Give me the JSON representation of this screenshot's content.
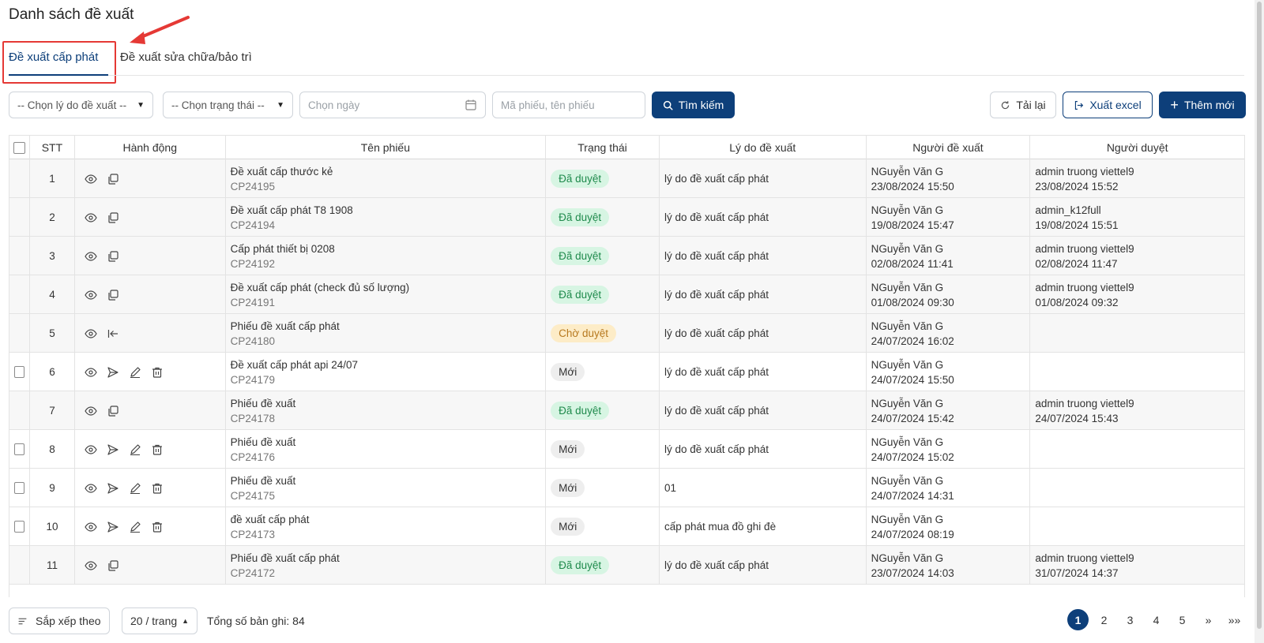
{
  "page": {
    "title": "Danh sách đề xuất"
  },
  "tabs": [
    {
      "label": "Đề xuất cấp phát",
      "active": true
    },
    {
      "label": "Đề xuất sửa chữa/bảo trì",
      "active": false
    }
  ],
  "filters": {
    "reason_select": "-- Chọn lý do đề xuất --",
    "status_select": "-- Chọn trạng thái --",
    "date_placeholder": "Chọn ngày",
    "search_placeholder": "Mã phiếu, tên phiếu",
    "search_button": "Tìm kiếm"
  },
  "toolbar": {
    "reload": "Tải lại",
    "export": "Xuất excel",
    "add_new": "Thêm mới"
  },
  "table": {
    "headers": [
      "STT",
      "Hành động",
      "Tên phiếu",
      "Trạng thái",
      "Lý do đề xuất",
      "Người đề xuất",
      "Người duyệt"
    ],
    "rows": [
      {
        "stt": "1",
        "name": "Đề xuất cấp thước kẻ",
        "code": "CP24195",
        "status": "Đã duyệt",
        "reason": "lý do đề xuất cấp phát",
        "proposer": "NGuyễn Văn G",
        "proposed_at": "23/08/2024 15:50",
        "approver": "admin truong viettel9",
        "approved_at": "23/08/2024 15:52"
      },
      {
        "stt": "2",
        "name": "Đề xuất cấp phát T8 1908",
        "code": "CP24194",
        "status": "Đã duyệt",
        "reason": "lý do đề xuất cấp phát",
        "proposer": "NGuyễn Văn G",
        "proposed_at": "19/08/2024 15:47",
        "approver": "admin_k12full",
        "approved_at": "19/08/2024 15:51"
      },
      {
        "stt": "3",
        "name": "Cấp phát thiết bị 0208",
        "code": "CP24192",
        "status": "Đã duyệt",
        "reason": "lý do đề xuất cấp phát",
        "proposer": "NGuyễn Văn G",
        "proposed_at": "02/08/2024 11:41",
        "approver": "admin truong viettel9",
        "approved_at": "02/08/2024 11:47"
      },
      {
        "stt": "4",
        "name": "Đề xuất cấp phát (check đủ số lượng)",
        "code": "CP24191",
        "status": "Đã duyệt",
        "reason": "lý do đề xuất cấp phát",
        "proposer": "NGuyễn Văn G",
        "proposed_at": "01/08/2024 09:30",
        "approver": "admin truong viettel9",
        "approved_at": "01/08/2024 09:32"
      },
      {
        "stt": "5",
        "name": "Phiếu đề xuất cấp phát",
        "code": "CP24180",
        "status": "Chờ duyệt",
        "reason": "lý do đề xuất cấp phát",
        "proposer": "NGuyễn Văn G",
        "proposed_at": "24/07/2024 16:02",
        "approver": "",
        "approved_at": ""
      },
      {
        "stt": "6",
        "name": "Đề xuất cấp phát api 24/07",
        "code": "CP24179",
        "status": "Mới",
        "reason": "lý do đề xuất cấp phát",
        "proposer": "NGuyễn Văn G",
        "proposed_at": "24/07/2024 15:50",
        "approver": "",
        "approved_at": ""
      },
      {
        "stt": "7",
        "name": "Phiếu đề xuất",
        "code": "CP24178",
        "status": "Đã duyệt",
        "reason": "lý do đề xuất cấp phát",
        "proposer": "NGuyễn Văn G",
        "proposed_at": "24/07/2024 15:42",
        "approver": "admin truong viettel9",
        "approved_at": "24/07/2024 15:43"
      },
      {
        "stt": "8",
        "name": "Phiếu đề xuất",
        "code": "CP24176",
        "status": "Mới",
        "reason": "lý do đề xuất cấp phát",
        "proposer": "NGuyễn Văn G",
        "proposed_at": "24/07/2024 15:02",
        "approver": "",
        "approved_at": ""
      },
      {
        "stt": "9",
        "name": "Phiếu đề xuất",
        "code": "CP24175",
        "status": "Mới",
        "reason": "01",
        "proposer": "NGuyễn Văn G",
        "proposed_at": "24/07/2024 14:31",
        "approver": "",
        "approved_at": ""
      },
      {
        "stt": "10",
        "name": "đề xuất cấp phát",
        "code": "CP24173",
        "status": "Mới",
        "reason": "cấp phát mua đồ ghi đè",
        "proposer": "NGuyễn Văn G",
        "proposed_at": "24/07/2024 08:19",
        "approver": "",
        "approved_at": ""
      },
      {
        "stt": "11",
        "name": "Phiếu đề xuất cấp phát",
        "code": "CP24172",
        "status": "Đã duyệt",
        "reason": "lý do đề xuất cấp phát",
        "proposer": "NGuyễn Văn G",
        "proposed_at": "23/07/2024 14:03",
        "approver": "admin truong viettel9",
        "approved_at": "31/07/2024 14:37"
      }
    ]
  },
  "footer": {
    "sort_label": "Sắp xếp theo",
    "page_size": "20 / trang",
    "total": "Tổng số bản ghi: 84",
    "pages": [
      "1",
      "2",
      "3",
      "4",
      "5"
    ],
    "next": "»",
    "last": "»»"
  },
  "colors": {
    "primary": "#0d3f7a",
    "highlight": "#e53935"
  }
}
